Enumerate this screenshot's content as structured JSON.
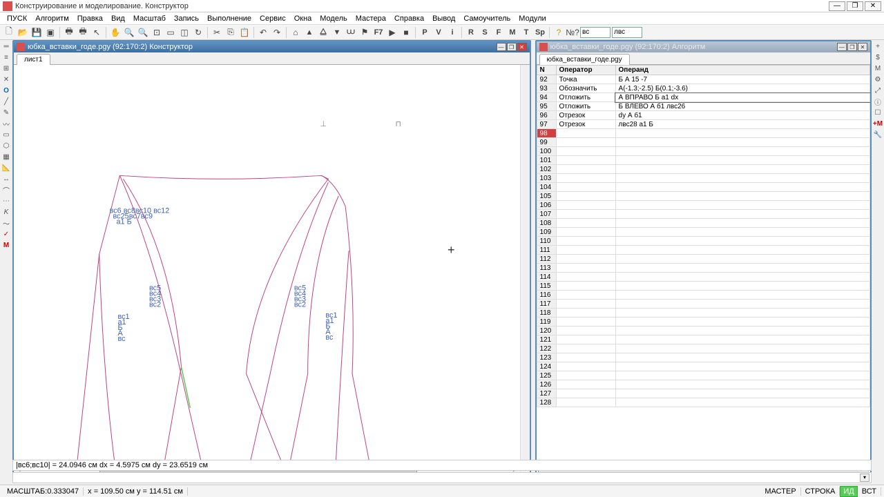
{
  "app": {
    "title": "Конструирование и моделирование. Конструктор"
  },
  "menu": [
    "ПУСК",
    "Алгоритм",
    "Правка",
    "Вид",
    "Масштаб",
    "Запись",
    "Выполнение",
    "Сервис",
    "Окна",
    "Модель",
    "Мастера",
    "Справка",
    "Вывод",
    "Самоучитель",
    "Модули"
  ],
  "toolbar": {
    "combo1": "вс",
    "combo2": "лвс",
    "txt": {
      "F7": "F7",
      "P": "P",
      "V": "V",
      "i": "i",
      "R": "R",
      "S": "S",
      "F": "F",
      "M": "M",
      "T": "T",
      "Sp": "Sp"
    }
  },
  "panels": {
    "left": {
      "title": "юбка_вставки_годе.pgy (92:170:2) Конструктор",
      "tab": "лист1"
    },
    "right": {
      "title": "юбка_вставки_годе.pgy (92:170:2) Алгоритм",
      "tab": "юбка_вставки_годе.pgy"
    }
  },
  "table": {
    "headers": {
      "n": "N",
      "op": "Оператор",
      "opr": "Операнд"
    },
    "rows": [
      {
        "n": "92",
        "op": "Точка",
        "opr": "Б А 15 -7"
      },
      {
        "n": "93",
        "op": "Обозначить",
        "opr": "А(-1.3;-2.5) Б(0.1;-3.6)"
      },
      {
        "n": "94",
        "op": "Отложить",
        "opr": "А ВПРАВО Б a1 dx",
        "sel": true
      },
      {
        "n": "95",
        "op": "Отложить",
        "opr": "Б ВЛЕВО А б1 лвс26"
      },
      {
        "n": "96",
        "op": "Отрезок",
        "opr": "dy А б1"
      },
      {
        "n": "97",
        "op": "Отрезок",
        "opr": "лвс28 a1 Б"
      },
      {
        "n": "98",
        "op": "",
        "opr": "",
        "hl": true
      },
      {
        "n": "99",
        "op": "",
        "opr": ""
      },
      {
        "n": "100",
        "op": "",
        "opr": ""
      },
      {
        "n": "101",
        "op": "",
        "opr": ""
      },
      {
        "n": "102",
        "op": "",
        "opr": ""
      },
      {
        "n": "103",
        "op": "",
        "opr": ""
      },
      {
        "n": "104",
        "op": "",
        "opr": ""
      },
      {
        "n": "105",
        "op": "",
        "opr": ""
      },
      {
        "n": "106",
        "op": "",
        "opr": ""
      },
      {
        "n": "107",
        "op": "",
        "opr": ""
      },
      {
        "n": "108",
        "op": "",
        "opr": ""
      },
      {
        "n": "109",
        "op": "",
        "opr": ""
      },
      {
        "n": "110",
        "op": "",
        "opr": ""
      },
      {
        "n": "111",
        "op": "",
        "opr": ""
      },
      {
        "n": "112",
        "op": "",
        "opr": ""
      },
      {
        "n": "113",
        "op": "",
        "opr": ""
      },
      {
        "n": "114",
        "op": "",
        "opr": ""
      },
      {
        "n": "115",
        "op": "",
        "opr": ""
      },
      {
        "n": "116",
        "op": "",
        "opr": ""
      },
      {
        "n": "117",
        "op": "",
        "opr": ""
      },
      {
        "n": "118",
        "op": "",
        "opr": ""
      },
      {
        "n": "119",
        "op": "",
        "opr": ""
      },
      {
        "n": "120",
        "op": "",
        "opr": ""
      },
      {
        "n": "121",
        "op": "",
        "opr": ""
      },
      {
        "n": "122",
        "op": "",
        "opr": ""
      },
      {
        "n": "123",
        "op": "",
        "opr": ""
      },
      {
        "n": "124",
        "op": "",
        "opr": ""
      },
      {
        "n": "125",
        "op": "",
        "opr": ""
      },
      {
        "n": "126",
        "op": "",
        "opr": ""
      },
      {
        "n": "127",
        "op": "",
        "opr": ""
      },
      {
        "n": "128",
        "op": "",
        "opr": ""
      }
    ]
  },
  "info1": "|вс6;вс10| = 24.0946 см   dx = 4.5975 см   dy = 23.6519 см",
  "status": {
    "scale": "МАСШТАБ:0.333047",
    "coords": "x = 109.50 см   y = 114.51 см",
    "master": "МАСТЕР",
    "line": "СТРОКА",
    "id": "ИД",
    "bct": "ВСТ"
  }
}
